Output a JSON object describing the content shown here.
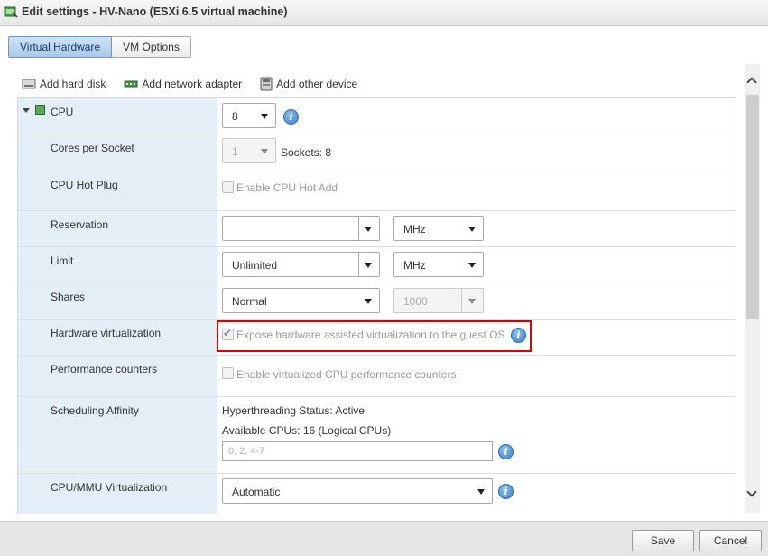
{
  "window": {
    "title": "Edit settings - HV-Nano (ESXi 6.5 virtual machine)"
  },
  "tabs": [
    {
      "label": "Virtual Hardware",
      "active": true
    },
    {
      "label": "VM Options",
      "active": false
    }
  ],
  "toolbar": {
    "add_hard_disk": "Add hard disk",
    "add_network_adapter": "Add network adapter",
    "add_other_device": "Add other device"
  },
  "cpu": {
    "label": "CPU",
    "value": "8",
    "cores_per_socket": {
      "label": "Cores per Socket",
      "value": "1",
      "sockets": "Sockets: 8"
    },
    "hot_plug": {
      "label": "CPU Hot Plug",
      "checkbox_label": "Enable CPU Hot Add",
      "checked": false
    },
    "reservation": {
      "label": "Reservation",
      "value": "",
      "unit": "MHz"
    },
    "limit": {
      "label": "Limit",
      "value": "Unlimited",
      "unit": "MHz"
    },
    "shares": {
      "label": "Shares",
      "value": "Normal",
      "amount": "1000"
    },
    "hw_virtualization": {
      "label": "Hardware virtualization",
      "checkbox_label": "Expose hardware assisted virtualization to the guest OS",
      "checked": true
    },
    "perf_counters": {
      "label": "Performance counters",
      "checkbox_label": "Enable virtualized CPU performance counters",
      "checked": false
    },
    "scheduling_affinity": {
      "label": "Scheduling Affinity",
      "hyperthreading": "Hyperthreading Status: Active",
      "available_cpus": "Available CPUs: 16 (Logical CPUs)",
      "placeholder": "0, 2, 4-7"
    },
    "mmu_virtualization": {
      "label": "CPU/MMU Virtualization",
      "value": "Automatic"
    }
  },
  "footer": {
    "save_label": "Save",
    "cancel_label": "Cancel"
  },
  "colors": {
    "accent": "#a9caec",
    "highlight": "#e00000",
    "label_bg": "#e4eef7"
  },
  "icons": [
    "vm-icon",
    "hard-disk-icon",
    "network-adapter-icon",
    "other-device-icon",
    "cpu-chip-icon",
    "info-icon",
    "chevron-up-icon",
    "chevron-down-icon"
  ]
}
